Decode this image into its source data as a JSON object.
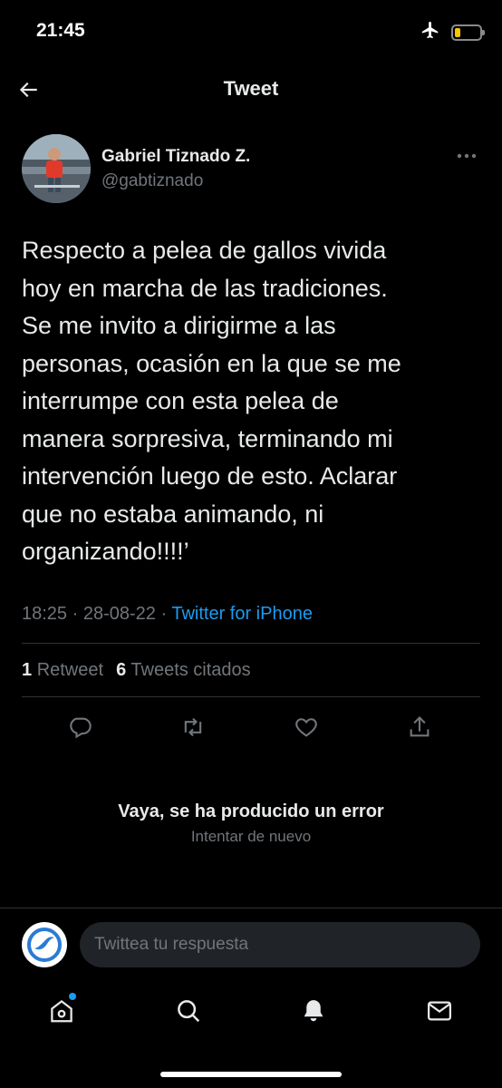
{
  "status_bar": {
    "time": "21:45",
    "battery_level": 0.22,
    "battery_color": "#f7c600"
  },
  "header": {
    "title": "Tweet"
  },
  "author": {
    "name": "Gabriel Tiznado Z.",
    "handle": "@gabtiznado"
  },
  "tweet": {
    "text": "Respecto a pelea de gallos vivida\nhoy en marcha de las tradiciones.\nSe me invito a dirigirme a las\npersonas, ocasión en la que se me\ninterrumpe con esta pelea de\nmanera sorpresiva, terminando mi\nintervención luego de esto. Aclarar\nque no estaba animando, ni\norganizando!!!!’",
    "time": "18:25",
    "date": "28-08-22",
    "source": "Twitter for iPhone"
  },
  "stats": {
    "retweets_count": "1",
    "retweets_label": "Retweet",
    "quotes_count": "6",
    "quotes_label": "Tweets citados"
  },
  "actions": [
    "reply-icon",
    "retweet-icon",
    "like-icon",
    "share-icon"
  ],
  "error": {
    "title": "Vaya, se ha producido un error",
    "retry": "Intentar de nuevo"
  },
  "reply": {
    "placeholder": "Twittea tu respuesta"
  },
  "tabbar": {
    "items": [
      "home-icon",
      "search-icon",
      "notifications-icon",
      "messages-icon"
    ]
  },
  "colors": {
    "accent": "#1d9bf0",
    "background": "#000000",
    "secondary_text": "#71767b"
  }
}
